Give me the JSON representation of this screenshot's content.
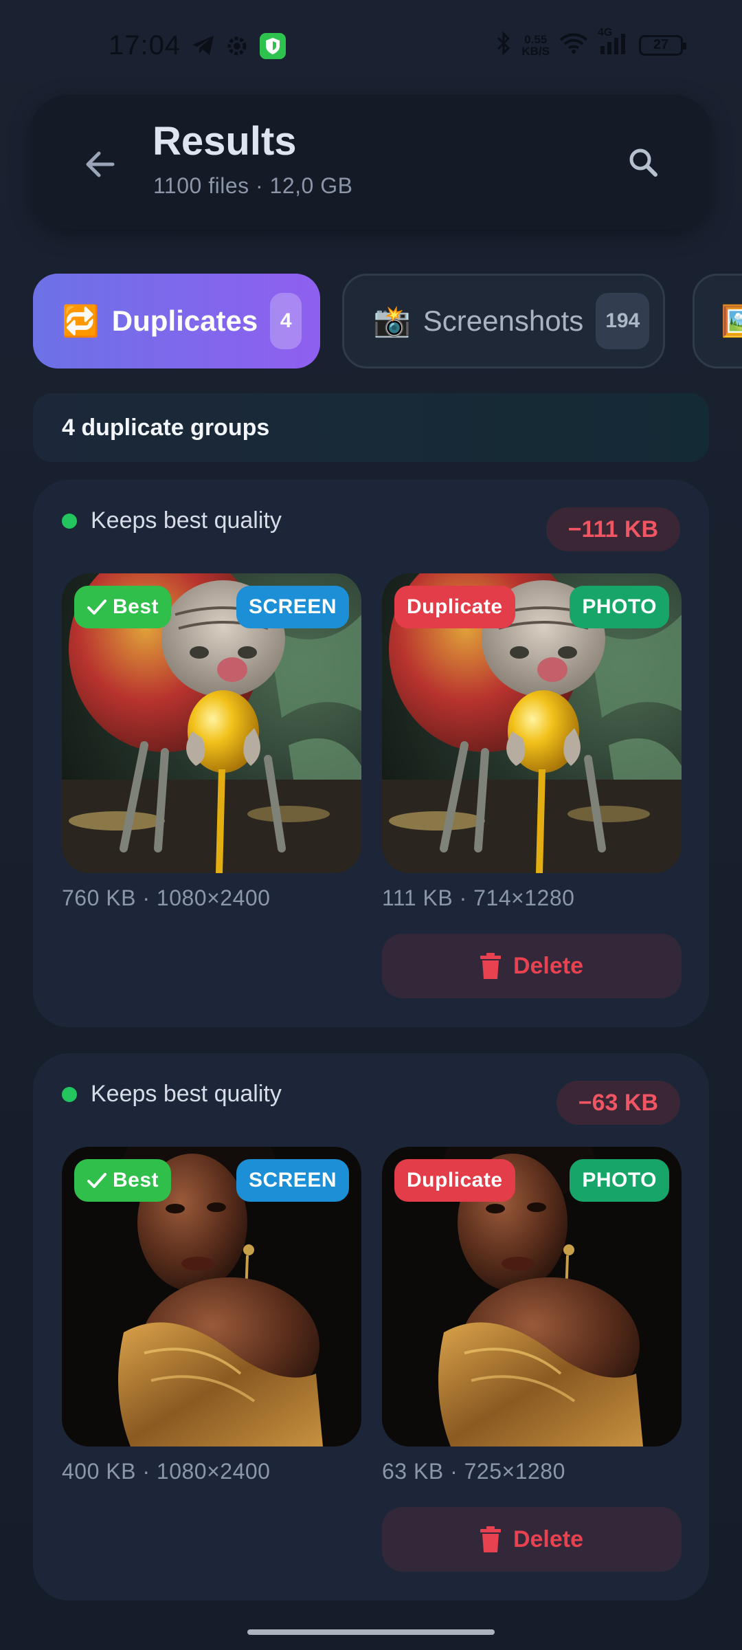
{
  "status_bar": {
    "time": "17:04",
    "net_speed_value": "0.55",
    "net_speed_unit": "KB/S",
    "network": "4G",
    "battery": "27"
  },
  "header": {
    "title": "Results",
    "subtitle": "1100 files · 12,0 GB"
  },
  "tabs": [
    {
      "emoji": "🔁",
      "label": "Duplicates",
      "count": "4",
      "active": true
    },
    {
      "emoji": "📸",
      "label": "Screenshots",
      "count": "194",
      "active": false
    },
    {
      "emoji": "🖼️",
      "label": "",
      "count": "",
      "active": false
    }
  ],
  "banner": {
    "text": "4 duplicate groups"
  },
  "groups": [
    {
      "label": "Keeps best quality",
      "saving": "−111 KB",
      "keep": {
        "badge": "Best",
        "source": "SCREEN",
        "meta": "760 KB · 1080×2400"
      },
      "duplicate": {
        "badge": "Duplicate",
        "source": "PHOTO",
        "meta": "111 KB · 714×1280"
      },
      "delete_label": "Delete"
    },
    {
      "label": "Keeps best quality",
      "saving": "−63 KB",
      "keep": {
        "badge": "Best",
        "source": "SCREEN",
        "meta": "400 KB · 1080×2400"
      },
      "duplicate": {
        "badge": "Duplicate",
        "source": "PHOTO",
        "meta": "63 KB · 725×1280"
      },
      "delete_label": "Delete"
    }
  ],
  "colors": {
    "accent_start": "#6c72e6",
    "accent_end": "#8f5ff0",
    "best": "#2fbf4a",
    "duplicate": "#e43d4a",
    "screen": "#1d8fd6",
    "photo": "#17a56a",
    "danger": "#f05564"
  },
  "icons": {
    "back": "arrow-left-icon",
    "search": "search-icon",
    "delete": "trash-icon",
    "check": "check-icon"
  }
}
